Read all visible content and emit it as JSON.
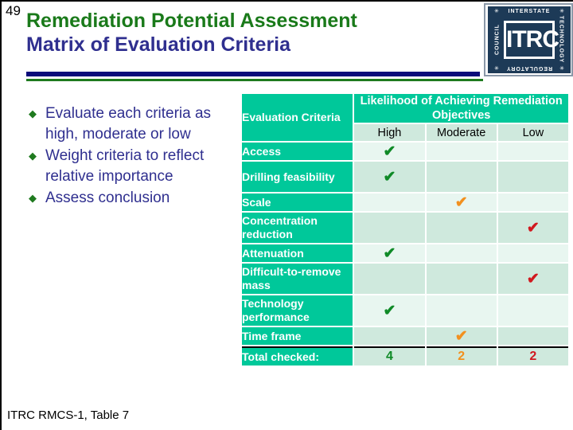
{
  "slide": {
    "number": "49",
    "title_line1": "Remediation Potential Assessment",
    "title_line2": "Matrix of Evaluation Criteria",
    "footer": "ITRC RMCS-1, Table 7"
  },
  "logo": {
    "center": "ITRC",
    "top": "INTERSTATE",
    "right": "TECHNOLOGY",
    "bottom": "REGULATORY",
    "left": "COUNCIL",
    "star": "✳"
  },
  "bullets": [
    {
      "marker": "◆",
      "text": "Evaluate each criteria as high, moderate or low"
    },
    {
      "marker": "◆",
      "text": "Weight criteria to reflect relative importance"
    },
    {
      "marker": "◆",
      "text": "Assess conclusion"
    }
  ],
  "table": {
    "criteria_header": "Evaluation Criteria",
    "objectives_header": "Likelihood of Achieving Remediation Objectives",
    "columns": [
      "High",
      "Moderate",
      "Low"
    ],
    "check_glyph": "✔",
    "rows": [
      {
        "label": "Access",
        "lines": 1,
        "mark": "High"
      },
      {
        "label": "Drilling feasibility",
        "lines": 2,
        "mark": "High"
      },
      {
        "label": "Scale",
        "lines": 1,
        "mark": "Moderate"
      },
      {
        "label": "Concentration reduction",
        "lines": 2,
        "mark": "Low"
      },
      {
        "label": "Attenuation",
        "lines": 1,
        "mark": "High"
      },
      {
        "label": "Difficult-to-remove mass",
        "lines": 2,
        "mark": "Low"
      },
      {
        "label": "Technology performance",
        "lines": 2,
        "mark": "High"
      },
      {
        "label": "Time frame",
        "lines": 1,
        "mark": "Moderate"
      }
    ],
    "total_label": "Total checked:",
    "totals": {
      "high": "4",
      "moderate": "2",
      "low": "2"
    }
  },
  "colors": {
    "teal": "#00C89A",
    "mint_light": "#E8F6F0",
    "mint_dark": "#CFE9DD",
    "title_green": "#1A7A1A",
    "title_navy": "#2F2F8F",
    "rule_navy": "#0B0B7A",
    "rule_green": "#1F7A1F",
    "check_high": "#0F8A27",
    "check_moderate": "#F2901E",
    "check_low": "#D1191F"
  }
}
